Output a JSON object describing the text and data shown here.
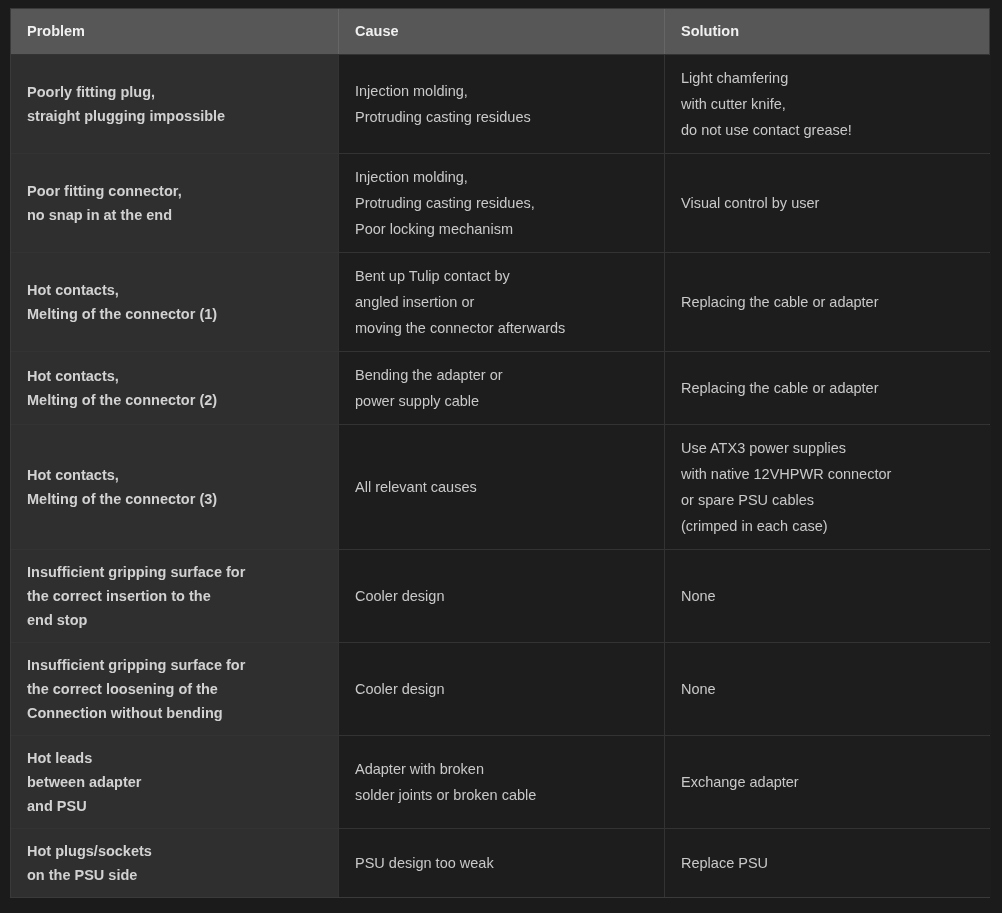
{
  "table": {
    "columns": [
      "Problem",
      "Cause",
      "Solution"
    ],
    "rows": [
      {
        "problem": "Poorly fitting plug,\nstraight plugging impossible",
        "cause": "Injection molding,\nProtruding casting residues",
        "solution": "Light chamfering\nwith cutter knife,\ndo not use contact grease!"
      },
      {
        "problem": "Poor fitting connector,\nno snap in at the end",
        "cause": "Injection molding,\nProtruding casting residues,\nPoor locking mechanism",
        "solution": "Visual control by user"
      },
      {
        "problem": "Hot contacts,\nMelting of the connector (1)",
        "cause": "Bent up Tulip contact by\nangled insertion or\nmoving the connector afterwards",
        "solution": "Replacing the cable or adapter"
      },
      {
        "problem": "Hot contacts,\nMelting of the connector (2)",
        "cause": "Bending the adapter or\npower supply cable",
        "solution": "Replacing the cable or adapter"
      },
      {
        "problem": "Hot contacts,\nMelting of the connector (3)",
        "cause": "All relevant causes",
        "solution": "Use ATX3 power supplies\nwith native 12VHPWR connector\nor spare PSU cables\n(crimped in each case)"
      },
      {
        "problem": "Insufficient gripping surface for\nthe correct insertion to the\nend stop",
        "cause": "Cooler design",
        "solution": "None"
      },
      {
        "problem": "Insufficient gripping surface for\nthe correct loosening of the\nConnection without bending",
        "cause": "Cooler design",
        "solution": "None"
      },
      {
        "problem": "Hot leads\nbetween adapter\nand PSU",
        "cause": "Adapter with broken\nsolder joints or broken cable",
        "solution": "Exchange adapter"
      },
      {
        "problem": "Hot plugs/sockets\non the PSU side",
        "cause": "PSU design too weak",
        "solution": "Replace PSU"
      }
    ]
  }
}
